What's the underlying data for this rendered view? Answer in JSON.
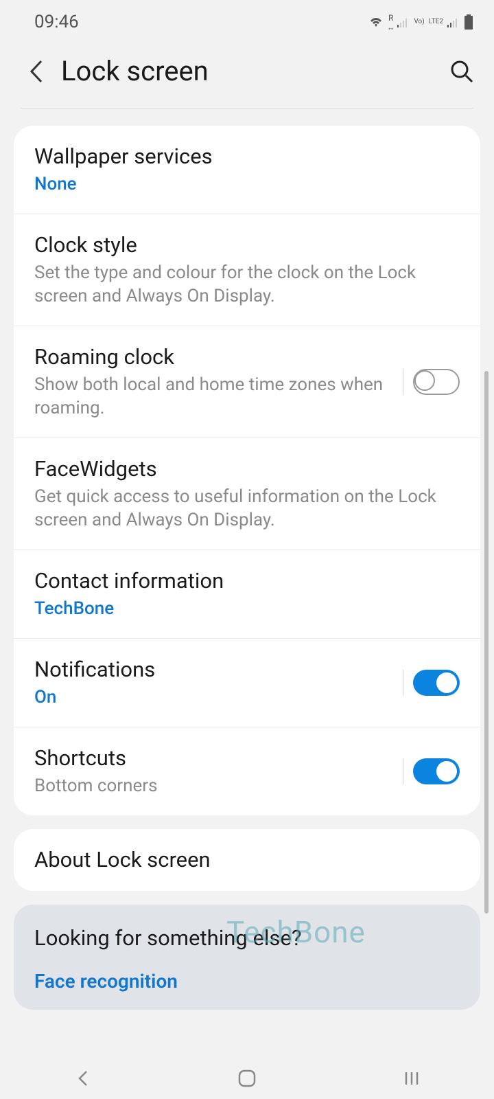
{
  "status": {
    "time": "09:46",
    "icons": {
      "roaming": "R",
      "lte": "LTE2",
      "vo": "Vo)"
    }
  },
  "header": {
    "title": "Lock screen"
  },
  "items": {
    "wallpaper": {
      "title": "Wallpaper services",
      "value": "None"
    },
    "clock": {
      "title": "Clock style",
      "desc": "Set the type and colour for the clock on the Lock screen and Always On Display."
    },
    "roaming": {
      "title": "Roaming clock",
      "desc": "Show both local and home time zones when roaming."
    },
    "facewidgets": {
      "title": "FaceWidgets",
      "desc": "Get quick access to useful information on the Lock screen and Always On Display."
    },
    "contact": {
      "title": "Contact information",
      "value": "TechBone"
    },
    "notifications": {
      "title": "Notifications",
      "value": "On"
    },
    "shortcuts": {
      "title": "Shortcuts",
      "desc": "Bottom corners"
    },
    "about": {
      "title": "About Lock screen"
    }
  },
  "footer": {
    "title": "Looking for something else?",
    "link": "Face recognition"
  },
  "watermark": "TechBone"
}
